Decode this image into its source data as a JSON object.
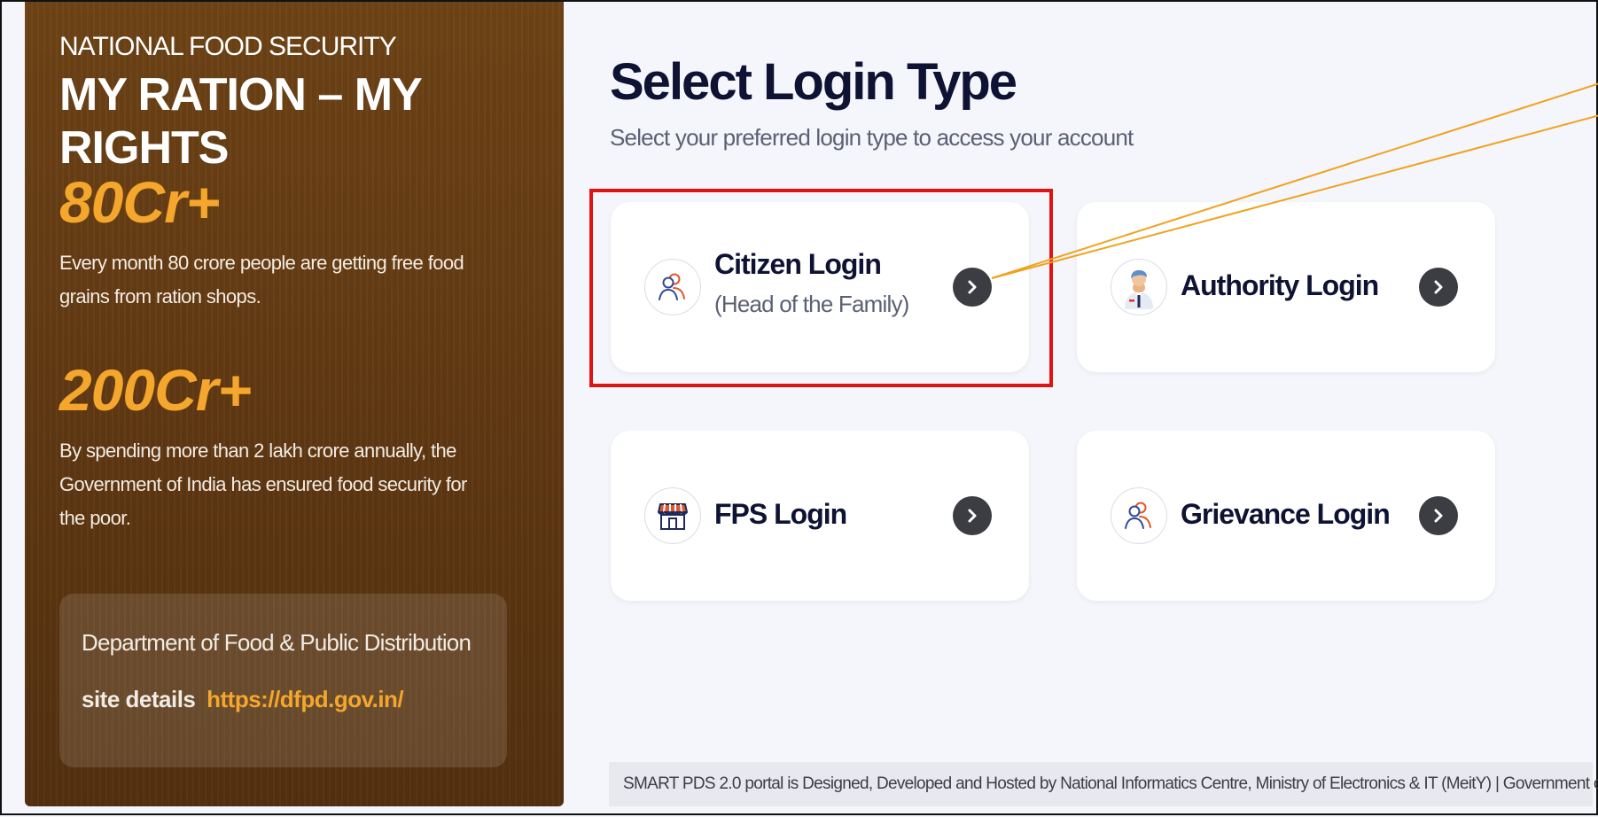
{
  "sidebar": {
    "kicker": "NATIONAL FOOD SECURITY",
    "headline": "MY RATION – MY RIGHTS",
    "stats": [
      {
        "value": "80Cr+",
        "description": "Every month 80 crore people are getting free food grains from ration shops."
      },
      {
        "value": "200Cr+",
        "description": "By spending more than 2 lakh crore annually, the Government of India has ensured food security for the poor."
      }
    ],
    "department": {
      "title": "Department of Food & Public Distribution",
      "site_label": "site details",
      "site_url": "https://dfpd.gov.in/"
    }
  },
  "main": {
    "title": "Select Login Type",
    "subtitle": "Select your preferred login type to access your account",
    "login_options": [
      {
        "label": "Citizen Login",
        "sublabel": "(Head of the Family)",
        "icon": "people-icon"
      },
      {
        "label": "Authority Login",
        "icon": "officer-icon"
      },
      {
        "label": "FPS Login",
        "icon": "shop-icon"
      },
      {
        "label": "Grievance Login",
        "icon": "people-icon"
      }
    ]
  },
  "footer": {
    "text": "SMART PDS 2.0 portal is Designed, Developed and Hosted by National Informatics Centre, Ministry of Electronics & IT (MeitY) | Government of India"
  },
  "colors": {
    "sidebar_bg": "#5e3712",
    "accent": "#f4a72c",
    "title": "#0e1233",
    "highlight": "#e01313",
    "callout_line": "#f0a21d",
    "button": "#3b3d42"
  }
}
